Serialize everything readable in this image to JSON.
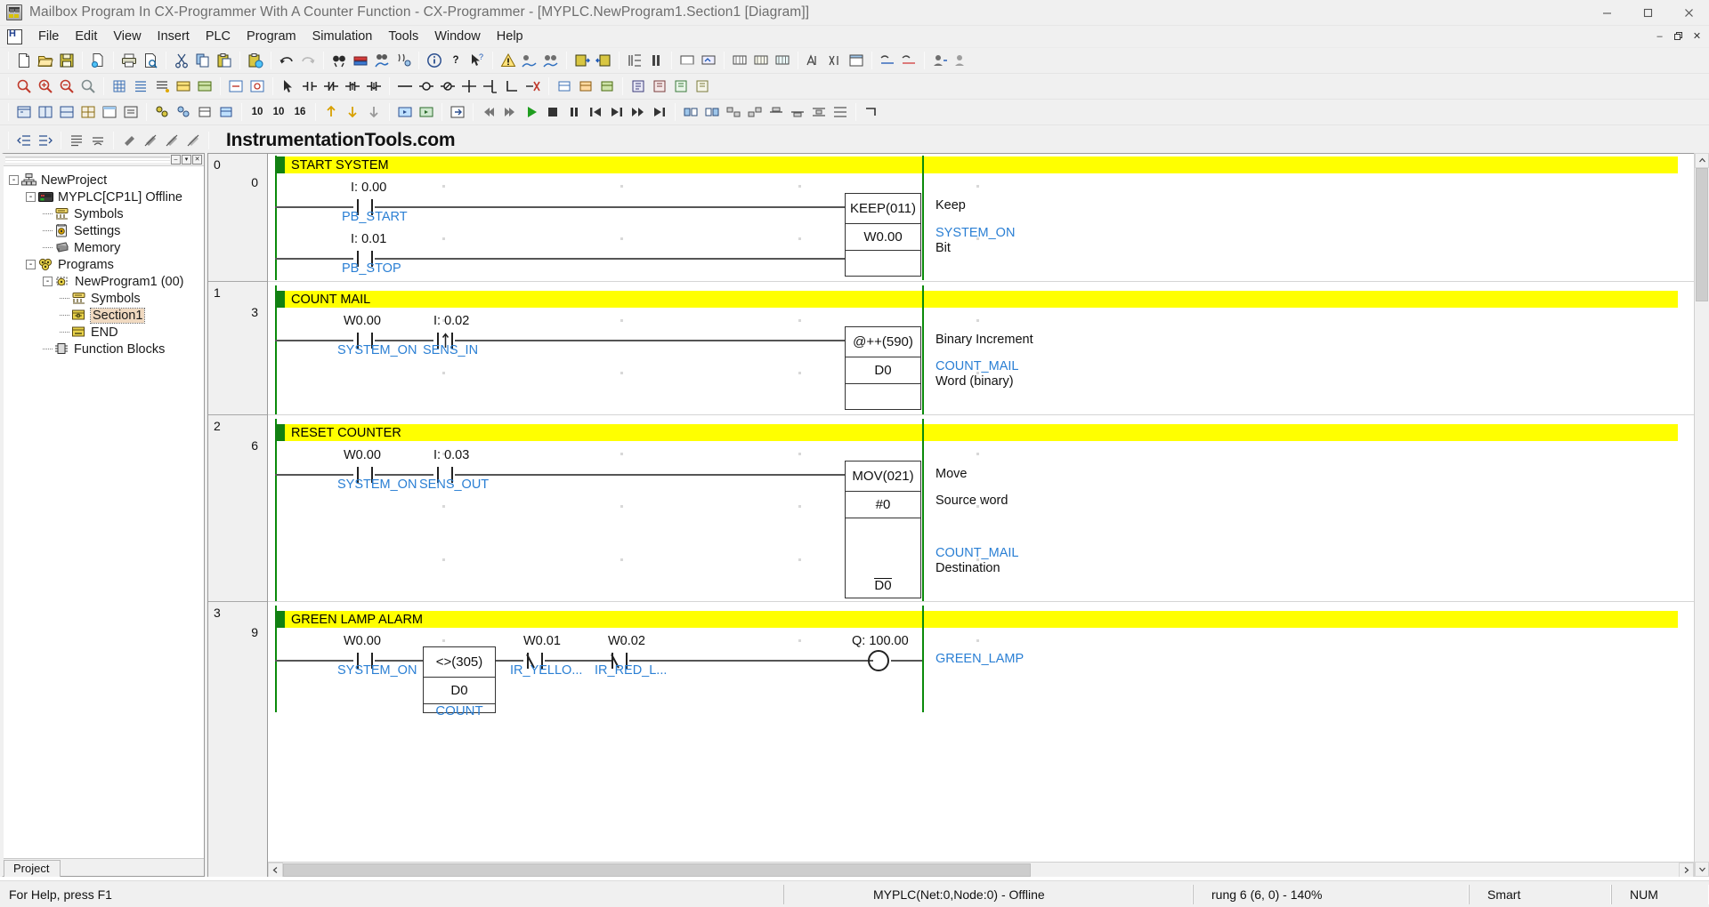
{
  "window": {
    "title": "Mailbox Program In CX-Programmer With A Counter Function - CX-Programmer - [MYPLC.NewProgram1.Section1 [Diagram]]",
    "minimize": "—",
    "maximize": "❐",
    "close": "✕"
  },
  "menu": {
    "items": [
      {
        "label": "File"
      },
      {
        "label": "Edit"
      },
      {
        "label": "View"
      },
      {
        "label": "Insert"
      },
      {
        "label": "PLC"
      },
      {
        "label": "Program"
      },
      {
        "label": "Simulation"
      },
      {
        "label": "Tools"
      },
      {
        "label": "Window"
      },
      {
        "label": "Help"
      }
    ],
    "mdi": {
      "minimize": "–",
      "restore": "❐",
      "close": "✕"
    }
  },
  "branding": {
    "text": "InstrumentationTools.com"
  },
  "toolbars": {
    "row1": [
      "new-icon",
      "open-icon",
      "save-icon",
      "sep",
      "print-report-icon",
      "sep",
      "print-icon",
      "print-preview-icon",
      "sep",
      "cut-icon",
      "copy-icon",
      "paste-icon",
      "sep",
      "paste-special-icon",
      "sep",
      "undo-icon",
      "redo-icon",
      "sep",
      "find-icon",
      "replace-icon",
      "compile-icon",
      "compare-icon",
      "sep",
      "info-icon",
      "help-context-icon",
      "help-arrow-icon",
      "sep",
      "error-icon",
      "online-icon",
      "online-sim-icon",
      "sep",
      "transfer-to-plc-icon",
      "transfer-from-plc-icon",
      "sep",
      "pause-icon",
      "step-icon",
      "sep",
      "monitor-icon",
      "monitor2-icon",
      "sep",
      "differential-icon",
      "differential2-icon",
      "differential3-icon",
      "sep",
      "address-ref-icon",
      "cross-ref-icon",
      "output-win-icon",
      "sep",
      "watch-icon",
      "watch2-icon",
      "sep",
      "user-icon",
      "user2-icon"
    ],
    "row2": [
      "zoom-icon",
      "zoom-in-icon",
      "zoom-out-icon",
      "zoom-fit-icon",
      "sep",
      "grid-icon",
      "list-icon",
      "list2-icon",
      "symbol-icon",
      "symbol2-icon",
      "sep",
      "rung-icon",
      "rung2-icon",
      "sep",
      "select-icon",
      "contact-no-icon",
      "contact-nc-icon",
      "contact-up-icon",
      "contact-down-icon",
      "sep",
      "hline-icon",
      "coil-icon",
      "coil-neg-icon",
      "vline-icon",
      "vline2-icon",
      "corner-icon",
      "delete-icon",
      "sep",
      "block1-icon",
      "block2-icon",
      "block3-icon",
      "sep",
      "fb1-icon",
      "fb2-icon",
      "fb3-icon",
      "fb4-icon",
      "sep",
      "chart1-icon",
      "chart2-icon",
      "chart3-icon",
      "chart4-icon"
    ],
    "row3": [
      "view1-icon",
      "view2-icon",
      "view3-icon",
      "view4-icon",
      "view5-icon",
      "view6-icon",
      "sep",
      "prop1-icon",
      "prop2-icon",
      "prop3-icon",
      "prop4-icon",
      "sep",
      "dec-icon",
      "hexa-icon",
      "hex16-icon",
      "sep",
      "up-icon",
      "down-icon",
      "down2-icon",
      "sep",
      "sim1-icon",
      "sim2-icon",
      "sep",
      "step-over-icon",
      "sep",
      "rewind-icon",
      "fforward-icon",
      "run-icon",
      "stop-icon",
      "pause2-icon",
      "prev-icon",
      "next-icon",
      "fast-icon",
      "end-icon",
      "sep",
      "align1-icon",
      "align2-icon",
      "align3-icon",
      "align4-icon",
      "align5-icon",
      "align6-icon",
      "align7-icon",
      "align8-icon",
      "sep",
      "corner2-icon"
    ],
    "row4": [
      "indent-left-icon",
      "indent-right-icon",
      "sep",
      "align-list-icon",
      "align-list2-icon",
      "sep",
      "pin-icon",
      "pin2-icon",
      "pin3-icon",
      "pin4-icon"
    ],
    "labels": {
      "dec": "10",
      "hexa": "10",
      "hex16": "16"
    }
  },
  "project_tree": {
    "nodes": [
      {
        "label": "NewProject",
        "icon": "project-icon",
        "depth": 0,
        "expander": "-"
      },
      {
        "label": "MYPLC[CP1L] Offline",
        "icon": "plc-icon",
        "depth": 1,
        "expander": "-"
      },
      {
        "label": "Symbols",
        "icon": "symbols-icon",
        "depth": 2,
        "expander": ""
      },
      {
        "label": "Settings",
        "icon": "settings-icon",
        "depth": 2,
        "expander": ""
      },
      {
        "label": "Memory",
        "icon": "memory-icon",
        "depth": 2,
        "expander": ""
      },
      {
        "label": "Programs",
        "icon": "programs-icon",
        "depth": 2,
        "expander": "-"
      },
      {
        "label": "NewProgram1 (00)",
        "icon": "program-icon",
        "depth": 3,
        "expander": "-"
      },
      {
        "label": "Symbols",
        "icon": "symbols-icon",
        "depth": 4,
        "expander": ""
      },
      {
        "label": "Section1",
        "icon": "section-icon",
        "depth": 4,
        "expander": "",
        "selected": true
      },
      {
        "label": "END",
        "icon": "end-icon",
        "depth": 4,
        "expander": ""
      },
      {
        "label": "Function Blocks",
        "icon": "function-blocks-icon",
        "depth": 2,
        "expander": ""
      }
    ],
    "tab": "Project"
  },
  "ladder": {
    "rungs": [
      {
        "number": "0",
        "step": "0",
        "comment": "START SYSTEM",
        "contacts": [
          {
            "address": "I: 0.00",
            "symbol": "PB_START",
            "type": "no"
          },
          {
            "address": "I: 0.01",
            "symbol": "PB_STOP",
            "type": "no"
          }
        ],
        "block": {
          "instruction": "KEEP(011)",
          "operands": [
            "W0.00"
          ],
          "comments": [
            {
              "text": "Keep",
              "symbol": false
            },
            {
              "text": "SYSTEM_ON",
              "symbol": true
            },
            {
              "text": "Bit",
              "symbol": false
            }
          ]
        }
      },
      {
        "number": "1",
        "step": "3",
        "comment": "COUNT MAIL",
        "contacts": [
          {
            "address": "W0.00",
            "symbol": "SYSTEM_ON",
            "type": "no"
          },
          {
            "address": "I: 0.02",
            "symbol": "SENS_IN",
            "type": "up"
          }
        ],
        "block": {
          "instruction": "@++(590)",
          "operands": [
            "D0"
          ],
          "comments": [
            {
              "text": "Binary Increment",
              "symbol": false
            },
            {
              "text": "COUNT_MAIL",
              "symbol": true
            },
            {
              "text": "Word (binary)",
              "symbol": false
            }
          ]
        }
      },
      {
        "number": "2",
        "step": "6",
        "comment": "RESET COUNTER",
        "contacts": [
          {
            "address": "W0.00",
            "symbol": "SYSTEM_ON",
            "type": "no"
          },
          {
            "address": "I: 0.03",
            "symbol": "SENS_OUT",
            "type": "no"
          }
        ],
        "block": {
          "instruction": "MOV(021)",
          "operands": [
            "#0",
            "D0"
          ],
          "comments": [
            {
              "text": "Move",
              "symbol": false
            },
            {
              "text": "Source word",
              "symbol": false
            },
            {
              "text": "COUNT_MAIL",
              "symbol": true
            },
            {
              "text": "Destination",
              "symbol": false
            }
          ]
        }
      },
      {
        "number": "3",
        "step": "9",
        "comment": "GREEN LAMP ALARM",
        "contacts": [
          {
            "address": "W0.00",
            "symbol": "SYSTEM_ON",
            "type": "no"
          },
          {
            "address": "W0.01",
            "symbol": "IR_YELLO...",
            "type": "nc"
          },
          {
            "address": "W0.02",
            "symbol": "IR_RED_L...",
            "type": "nc"
          }
        ],
        "compare_block": {
          "instruction": "<>(305)",
          "operands": [
            "D0",
            "COUNT"
          ]
        },
        "coil": {
          "address": "Q: 100.00",
          "symbol": "GREEN_LAMP"
        }
      }
    ]
  },
  "statusbar": {
    "help": "For Help, press F1",
    "plc": "MYPLC(Net:0,Node:0) - Offline",
    "position": "rung 6 (6, 0)  - 140%",
    "mode": "Smart",
    "num": "NUM"
  },
  "colors": {
    "comment_bg": "#ffff00",
    "comment_swatch": "#128012",
    "symbol_text": "#2a7fd4",
    "busbar": "#0a8a0a",
    "wire": "#555555"
  }
}
